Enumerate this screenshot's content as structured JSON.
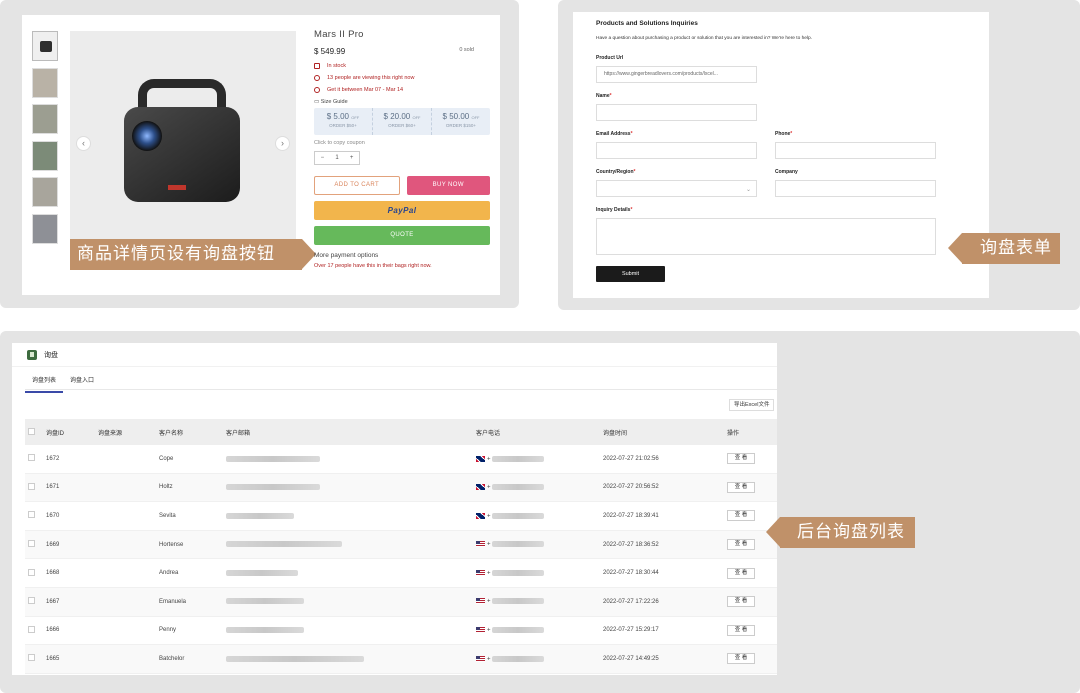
{
  "product": {
    "title": "Mars II Pro",
    "price": "$ 549.99",
    "sold": "0 sold",
    "in_stock": "In stock",
    "viewing": "13 people are viewing this right now",
    "delivery": "Get it between Mar 07 - Mar 14",
    "size_guide": "Size Guide",
    "coupons": [
      {
        "amount": "$ 5.00",
        "off": "OFF",
        "order": "ORDER $50+"
      },
      {
        "amount": "$ 20.00",
        "off": "OFF",
        "order": "ORDER $60+"
      },
      {
        "amount": "$ 50.00",
        "off": "OFF",
        "order": "ORDER $150+"
      }
    ],
    "copy_hint": "Click to copy coupon",
    "qty_minus": "−",
    "qty": "1",
    "qty_plus": "+",
    "add_to_cart": "ADD TO CART",
    "buy_now": "BUY NOW",
    "paypal": "PayPal",
    "quote": "QUOTE",
    "more_payment": "More payment options",
    "bags": "Over 17 people have this in their bags right now.",
    "prev": "‹",
    "next": "›",
    "callout": "商品详情页设有询盘按钮"
  },
  "form": {
    "title": "Products and Solutions Inquiries",
    "subtitle": "Have a question about purchasing a product or solution that you are interested in? We're here to help.",
    "product_url_label": "Product Url",
    "product_url_value": "https://www.gingerbreadlovers.com/products/lxcel...",
    "name_label": "Name",
    "email_label": "Email Address",
    "phone_label": "Phone",
    "country_label": "Country/Region",
    "company_label": "Company",
    "details_label": "Inquiry Details",
    "required_mark": "*",
    "submit": "Submit",
    "callout": "询盘表单"
  },
  "admin": {
    "title": "询盘",
    "tabs": [
      "询盘列表",
      "询盘入口"
    ],
    "export": "导出Excel文件",
    "columns": [
      "询盘ID",
      "询盘来源",
      "客户名称",
      "客户邮箱",
      "客户电话",
      "询盘时间",
      "操作"
    ],
    "rows": [
      {
        "id": "1672",
        "name": "Cope",
        "flag": "uk",
        "time": "2022-07-27 21:02:56"
      },
      {
        "id": "1671",
        "name": "Holtz",
        "flag": "uk",
        "time": "2022-07-27 20:56:52"
      },
      {
        "id": "1670",
        "name": "Sevita",
        "flag": "uk",
        "time": "2022-07-27 18:39:41"
      },
      {
        "id": "1669",
        "name": "Hortense",
        "flag": "us",
        "time": "2022-07-27 18:36:52"
      },
      {
        "id": "1668",
        "name": "Andrea",
        "flag": "us",
        "time": "2022-07-27 18:30:44"
      },
      {
        "id": "1667",
        "name": "Emanuela",
        "flag": "us",
        "time": "2022-07-27 17:22:26"
      },
      {
        "id": "1666",
        "name": "Penny",
        "flag": "us",
        "time": "2022-07-27 15:29:17"
      },
      {
        "id": "1665",
        "name": "Batchelor",
        "flag": "us",
        "time": "2022-07-27 14:49:25"
      }
    ],
    "view_label": "查 看",
    "phone_prefix": "+",
    "callout": "后台询盘列表"
  },
  "colors": {
    "callout": "#c09169",
    "add_to_cart": "#d9845b",
    "buy_now": "#e0567d",
    "paypal": "#f2b54c",
    "quote": "#66b95b",
    "alert_red": "#b02222",
    "tab_active": "#3a4aa8"
  },
  "icons": [
    "chevron-left-icon",
    "chevron-right-icon",
    "box-icon",
    "eye-icon",
    "clock-icon",
    "ruler-icon",
    "chevron-down-icon",
    "flag-uk-icon",
    "flag-us-icon",
    "app-logo-icon"
  ]
}
